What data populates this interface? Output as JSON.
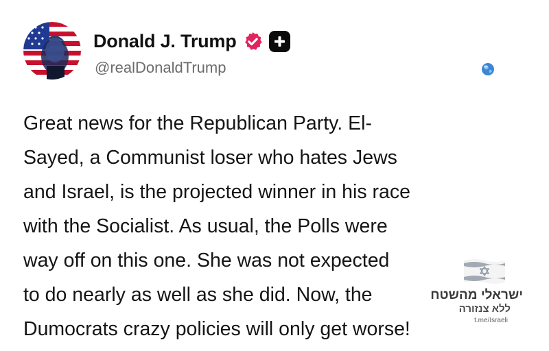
{
  "post": {
    "author": {
      "display_name": "Donald J. Trump",
      "handle": "@realDonaldTrump",
      "verified_icon": "verified-badge-icon",
      "verified_color": "#e0245e",
      "plus_icon": "plus-badge-icon"
    },
    "globe_icon": "globe-icon",
    "text_lines": [
      "Great news for the Republican Party. El-",
      "Sayed, a Communist loser who hates Jews",
      "and Israel, is the projected winner in his race",
      "with the Socialist. As usual, the Polls were",
      "way off on this one. She was not expected",
      "to do nearly as well as she did. Now, the",
      "Dumocrats crazy policies will only get worse!"
    ]
  },
  "watermark": {
    "icon": "israel-flag-icon",
    "line1": "ישראלי מהשטח",
    "line2": "ללא צנזורה",
    "line3": "t.me/Israeli"
  }
}
